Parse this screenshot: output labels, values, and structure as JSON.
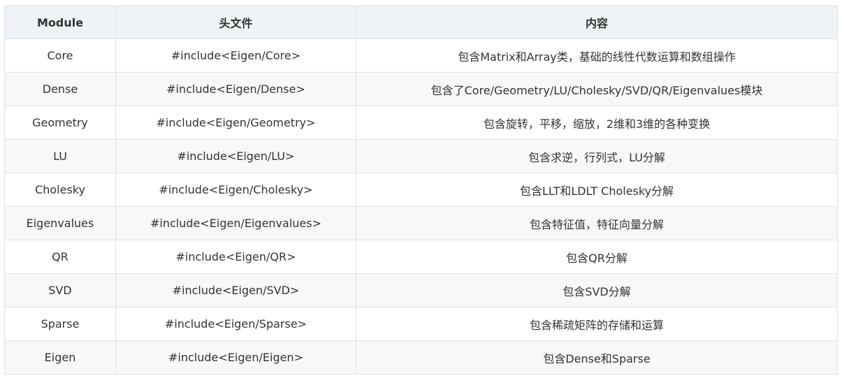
{
  "table": {
    "headers": [
      "Module",
      "头文件",
      "内容"
    ],
    "rows": [
      {
        "module": "Core",
        "header": "#include<Eigen/Core>",
        "content": "包含Matrix和Array类，基础的线性代数运算和数组操作"
      },
      {
        "module": "Dense",
        "header": "#include<Eigen/Dense>",
        "content": "包含了Core/Geometry/LU/Cholesky/SVD/QR/Eigenvalues模块"
      },
      {
        "module": "Geometry",
        "header": "#include<Eigen/Geometry>",
        "content": "包含旋转，平移，缩放，2维和3维的各种变换"
      },
      {
        "module": "LU",
        "header": "#include<Eigen/LU>",
        "content": "包含求逆，行列式，LU分解"
      },
      {
        "module": "Cholesky",
        "header": "#include<Eigen/Cholesky>",
        "content": "包含LLT和LDLT Cholesky分解"
      },
      {
        "module": "Eigenvalues",
        "header": "#include<Eigen/Eigenvalues>",
        "content": "包含特征值，特征向量分解"
      },
      {
        "module": "QR",
        "header": "#include<Eigen/QR>",
        "content": "包含QR分解"
      },
      {
        "module": "SVD",
        "header": "#include<Eigen/SVD>",
        "content": "包含SVD分解"
      },
      {
        "module": "Sparse",
        "header": "#include<Eigen/Sparse>",
        "content": "包含稀疏矩阵的存储和运算"
      },
      {
        "module": "Eigen",
        "header": "#include<Eigen/Eigen>",
        "content": "包含Dense和Sparse"
      }
    ]
  }
}
